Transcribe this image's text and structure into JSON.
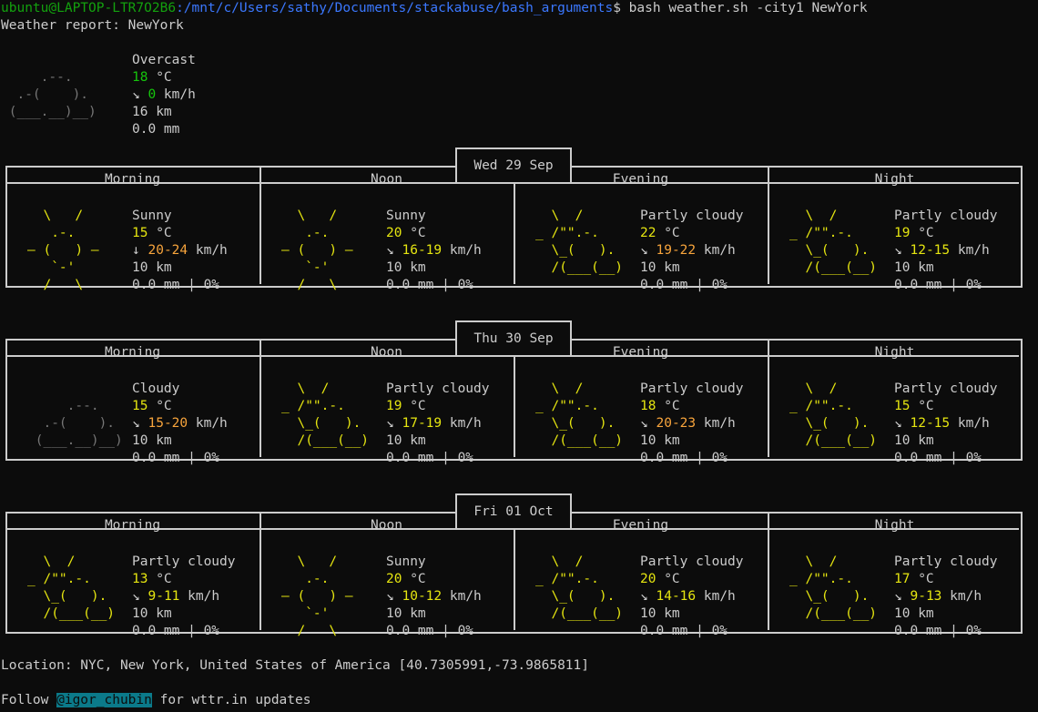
{
  "prompt": {
    "user_host": "ubuntu@LAPTOP-LTR7O2B6",
    "path": ":/mnt/c/Users/sathy/Documents/stackabuse/bash_arguments",
    "symbol": "$",
    "command": " bash weather.sh -city1 NewYork"
  },
  "report_title": "Weather report: NewYork",
  "current": {
    "art": [
      "     .--.    ",
      "  .-(    ).  ",
      " (___.__)__) "
    ],
    "condition": "Overcast",
    "temp": "18",
    "temp_unit": " °C",
    "wind_arrow": "↘ ",
    "wind": "0",
    "wind_unit": " km/h",
    "visibility": "16 km",
    "precip": "0.0 mm"
  },
  "days": [
    {
      "date": "Wed 29 Sep",
      "periods": [
        {
          "label": "Morning",
          "art": [
            "  \\   /  ",
            "   .-.   ",
            "― (   ) ―",
            "   `-'   ",
            "  /   \\  "
          ],
          "art_type": "sunny",
          "condition": "Sunny",
          "temp": "15",
          "wind_arrow": "↓ ",
          "wind_low": "20",
          "wind_high": "24",
          "wind_color": "orange",
          "visibility": "10 km",
          "precip": "0.0 mm | 0%"
        },
        {
          "label": "Noon",
          "art": [
            "  \\   /  ",
            "   .-.   ",
            "― (   ) ―",
            "   `-'   ",
            "  /   \\  "
          ],
          "art_type": "sunny",
          "condition": "Sunny",
          "temp": "20",
          "wind_arrow": "↘ ",
          "wind_low": "16",
          "wind_high": "19",
          "wind_color": "yellow",
          "visibility": "10 km",
          "precip": "0.0 mm | 0%"
        },
        {
          "label": "Evening",
          "art": [
            "  \\  /      ",
            "_ /\"\".-.    ",
            "  \\_(   ).  ",
            "  /(___(__) ",
            "            "
          ],
          "art_type": "partly",
          "condition": "Partly cloudy",
          "temp": "22",
          "wind_arrow": "↘ ",
          "wind_low": "19",
          "wind_high": "22",
          "wind_color": "orange",
          "visibility": "10 km",
          "precip": "0.0 mm | 0%"
        },
        {
          "label": "Night",
          "art": [
            "  \\  /      ",
            "_ /\"\".-.    ",
            "  \\_(   ).  ",
            "  /(___(__) ",
            "            "
          ],
          "art_type": "partly",
          "condition": "Partly cloudy",
          "temp": "19",
          "wind_arrow": "↘ ",
          "wind_low": "12",
          "wind_high": "15",
          "wind_color": "yellow",
          "visibility": "10 km",
          "precip": "0.0 mm | 0%"
        }
      ]
    },
    {
      "date": "Thu 30 Sep",
      "periods": [
        {
          "label": "Morning",
          "art": [
            "             ",
            "     .--.    ",
            "  .-(    ).  ",
            " (___.__)__) ",
            "             "
          ],
          "art_type": "cloudy",
          "condition": "Cloudy",
          "temp": "15",
          "wind_arrow": "↘ ",
          "wind_low": "15",
          "wind_high": "20",
          "wind_color": "orange",
          "visibility": "10 km",
          "precip": "0.0 mm | 0%"
        },
        {
          "label": "Noon",
          "art": [
            "  \\  /      ",
            "_ /\"\".-.    ",
            "  \\_(   ).  ",
            "  /(___(__) ",
            "            "
          ],
          "art_type": "partly",
          "condition": "Partly cloudy",
          "temp": "19",
          "wind_arrow": "↘ ",
          "wind_low": "17",
          "wind_high": "19",
          "wind_color": "yellow",
          "visibility": "10 km",
          "precip": "0.0 mm | 0%"
        },
        {
          "label": "Evening",
          "art": [
            "  \\  /      ",
            "_ /\"\".-.    ",
            "  \\_(   ).  ",
            "  /(___(__) ",
            "            "
          ],
          "art_type": "partly",
          "condition": "Partly cloudy",
          "temp": "18",
          "wind_arrow": "↘ ",
          "wind_low": "20",
          "wind_high": "23",
          "wind_color": "orange",
          "visibility": "10 km",
          "precip": "0.0 mm | 0%"
        },
        {
          "label": "Night",
          "art": [
            "  \\  /      ",
            "_ /\"\".-.    ",
            "  \\_(   ).  ",
            "  /(___(__) ",
            "            "
          ],
          "art_type": "partly",
          "condition": "Partly cloudy",
          "temp": "15",
          "wind_arrow": "↘ ",
          "wind_low": "12",
          "wind_high": "15",
          "wind_color": "yellow",
          "visibility": "10 km",
          "precip": "0.0 mm | 0%"
        }
      ]
    },
    {
      "date": "Fri 01 Oct",
      "periods": [
        {
          "label": "Morning",
          "art": [
            "  \\  /      ",
            "_ /\"\".-.    ",
            "  \\_(   ).  ",
            "  /(___(__) ",
            "            "
          ],
          "art_type": "partly",
          "condition": "Partly cloudy",
          "temp": "13",
          "wind_arrow": "↘ ",
          "wind_low": "9",
          "wind_high": "11",
          "wind_color": "yellow",
          "visibility": "10 km",
          "precip": "0.0 mm | 0%"
        },
        {
          "label": "Noon",
          "art": [
            "  \\   /  ",
            "   .-.   ",
            "― (   ) ―",
            "   `-'   ",
            "  /   \\  "
          ],
          "art_type": "sunny",
          "condition": "Sunny",
          "temp": "20",
          "wind_arrow": "↘ ",
          "wind_low": "10",
          "wind_high": "12",
          "wind_color": "yellow",
          "visibility": "10 km",
          "precip": "0.0 mm | 0%"
        },
        {
          "label": "Evening",
          "art": [
            "  \\  /      ",
            "_ /\"\".-.    ",
            "  \\_(   ).  ",
            "  /(___(__) ",
            "            "
          ],
          "art_type": "partly",
          "condition": "Partly cloudy",
          "temp": "20",
          "wind_arrow": "↘ ",
          "wind_low": "14",
          "wind_high": "16",
          "wind_color": "yellow",
          "visibility": "10 km",
          "precip": "0.0 mm | 0%"
        },
        {
          "label": "Night",
          "art": [
            "  \\  /      ",
            "_ /\"\".-.    ",
            "  \\_(   ).  ",
            "  /(___(__) ",
            "            "
          ],
          "art_type": "partly",
          "condition": "Partly cloudy",
          "temp": "17",
          "wind_arrow": "↘ ",
          "wind_low": "9",
          "wind_high": "13",
          "wind_color": "yellow",
          "visibility": "10 km",
          "precip": "0.0 mm | 0%"
        }
      ]
    }
  ],
  "temp_unit": " °C",
  "wind_unit": " km/h",
  "location": "Location: NYC, New York, United States of America [40.7305991,-73.9865811]",
  "footer": {
    "prefix": "Follow ",
    "handle": "@igor_chubin",
    "suffix": " for wttr.in updates"
  },
  "colors": {
    "background": "#0c0c0c",
    "text": "#cccccc",
    "user": "#13a10e",
    "path": "#3b78ff",
    "temp": "#16c60c",
    "sun": "#f9f1a5",
    "wind_orange": "#f7a43c",
    "handle_bg": "#0b7a8a"
  }
}
